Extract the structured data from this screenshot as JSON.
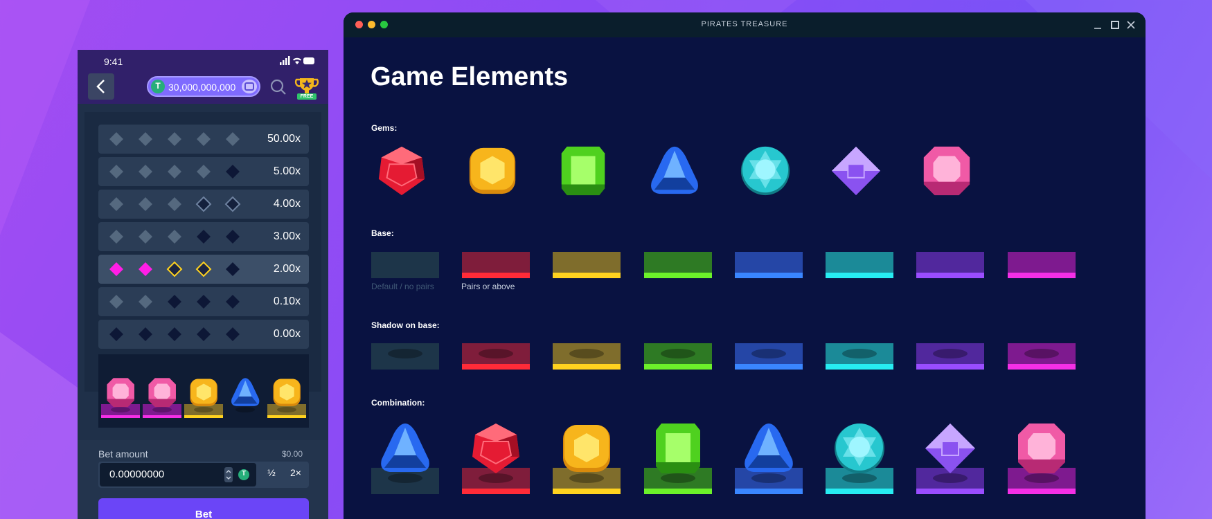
{
  "phone": {
    "status_time": "9:41",
    "balance": "30,000,000,000",
    "currency_symbol": "T",
    "trophy_badge": "FREE",
    "paytable": [
      {
        "multiplier": "50.00x",
        "pattern": [
          "m",
          "m",
          "m",
          "m",
          "m"
        ]
      },
      {
        "multiplier": "5.00x",
        "pattern": [
          "m",
          "m",
          "m",
          "m",
          "d"
        ]
      },
      {
        "multiplier": "4.00x",
        "pattern": [
          "m",
          "m",
          "m",
          "o",
          "o"
        ]
      },
      {
        "multiplier": "3.00x",
        "pattern": [
          "m",
          "m",
          "m",
          "d",
          "d"
        ]
      },
      {
        "multiplier": "2.00x",
        "pattern": [
          "p",
          "p",
          "y",
          "y",
          "d"
        ],
        "active": true
      },
      {
        "multiplier": "0.10x",
        "pattern": [
          "m",
          "m",
          "d",
          "d",
          "d"
        ]
      },
      {
        "multiplier": "0.00x",
        "pattern": [
          "d",
          "d",
          "d",
          "d",
          "d"
        ]
      }
    ],
    "tray": [
      "pink",
      "pink",
      "yellow",
      "blue",
      "yellow"
    ],
    "tray_bases": [
      "magenta",
      "magenta",
      "yellow",
      "empty",
      "yellow"
    ],
    "bet_label": "Bet amount",
    "bet_usd": "$0.00",
    "bet_value": "0.00000000",
    "half_label": "½",
    "double_label": "2×",
    "bet_button": "Bet"
  },
  "window": {
    "title": "PIRATES TREASURE",
    "page_title": "Game Elements",
    "sections": {
      "gems": "Gems:",
      "base": "Base:",
      "shadow": "Shadow on base:",
      "combination": "Combination:"
    },
    "gems": [
      "red",
      "yellow",
      "green",
      "blue",
      "cyan",
      "purple",
      "pink"
    ],
    "base_captions": {
      "default": "Default / no pairs",
      "pairs": "Pairs or above"
    },
    "combination": [
      "blue",
      "red",
      "yellow",
      "green",
      "blue",
      "cyan",
      "purple",
      "pink"
    ]
  },
  "colors": {
    "bases": {
      "default": {
        "top": "#1d3549",
        "stripe": "#1d3549"
      },
      "red": {
        "top": "#7f1d3b",
        "stripe": "#ff2b38"
      },
      "yellow": {
        "top": "#7f6d2c",
        "stripe": "#ffd21f"
      },
      "green": {
        "top": "#2e7a24",
        "stripe": "#6cf12a"
      },
      "blue": {
        "top": "#2546a6",
        "stripe": "#3a86ff"
      },
      "cyan": {
        "top": "#1b8a98",
        "stripe": "#27ecf2"
      },
      "purple": {
        "top": "#51289d",
        "stripe": "#9a4dff"
      },
      "magenta": {
        "top": "#7e1a8f",
        "stripe": "#f42fe6"
      }
    },
    "gems": {
      "red": [
        "#ff6b7a",
        "#e51b33",
        "#a50f24"
      ],
      "yellow": [
        "#ffe56a",
        "#f7b51c",
        "#d98a0c"
      ],
      "green": [
        "#a6ff6a",
        "#4fd11f",
        "#2a8f12"
      ],
      "blue": [
        "#6fb2ff",
        "#2869f0",
        "#123f9e"
      ],
      "cyan": [
        "#9ff6ff",
        "#27c7cf",
        "#117c86"
      ],
      "purple": [
        "#c7a6ff",
        "#8a52f0",
        "#5a2ab8"
      ],
      "pink": [
        "#ffb3d9",
        "#f05aa6",
        "#b82a74"
      ]
    }
  }
}
